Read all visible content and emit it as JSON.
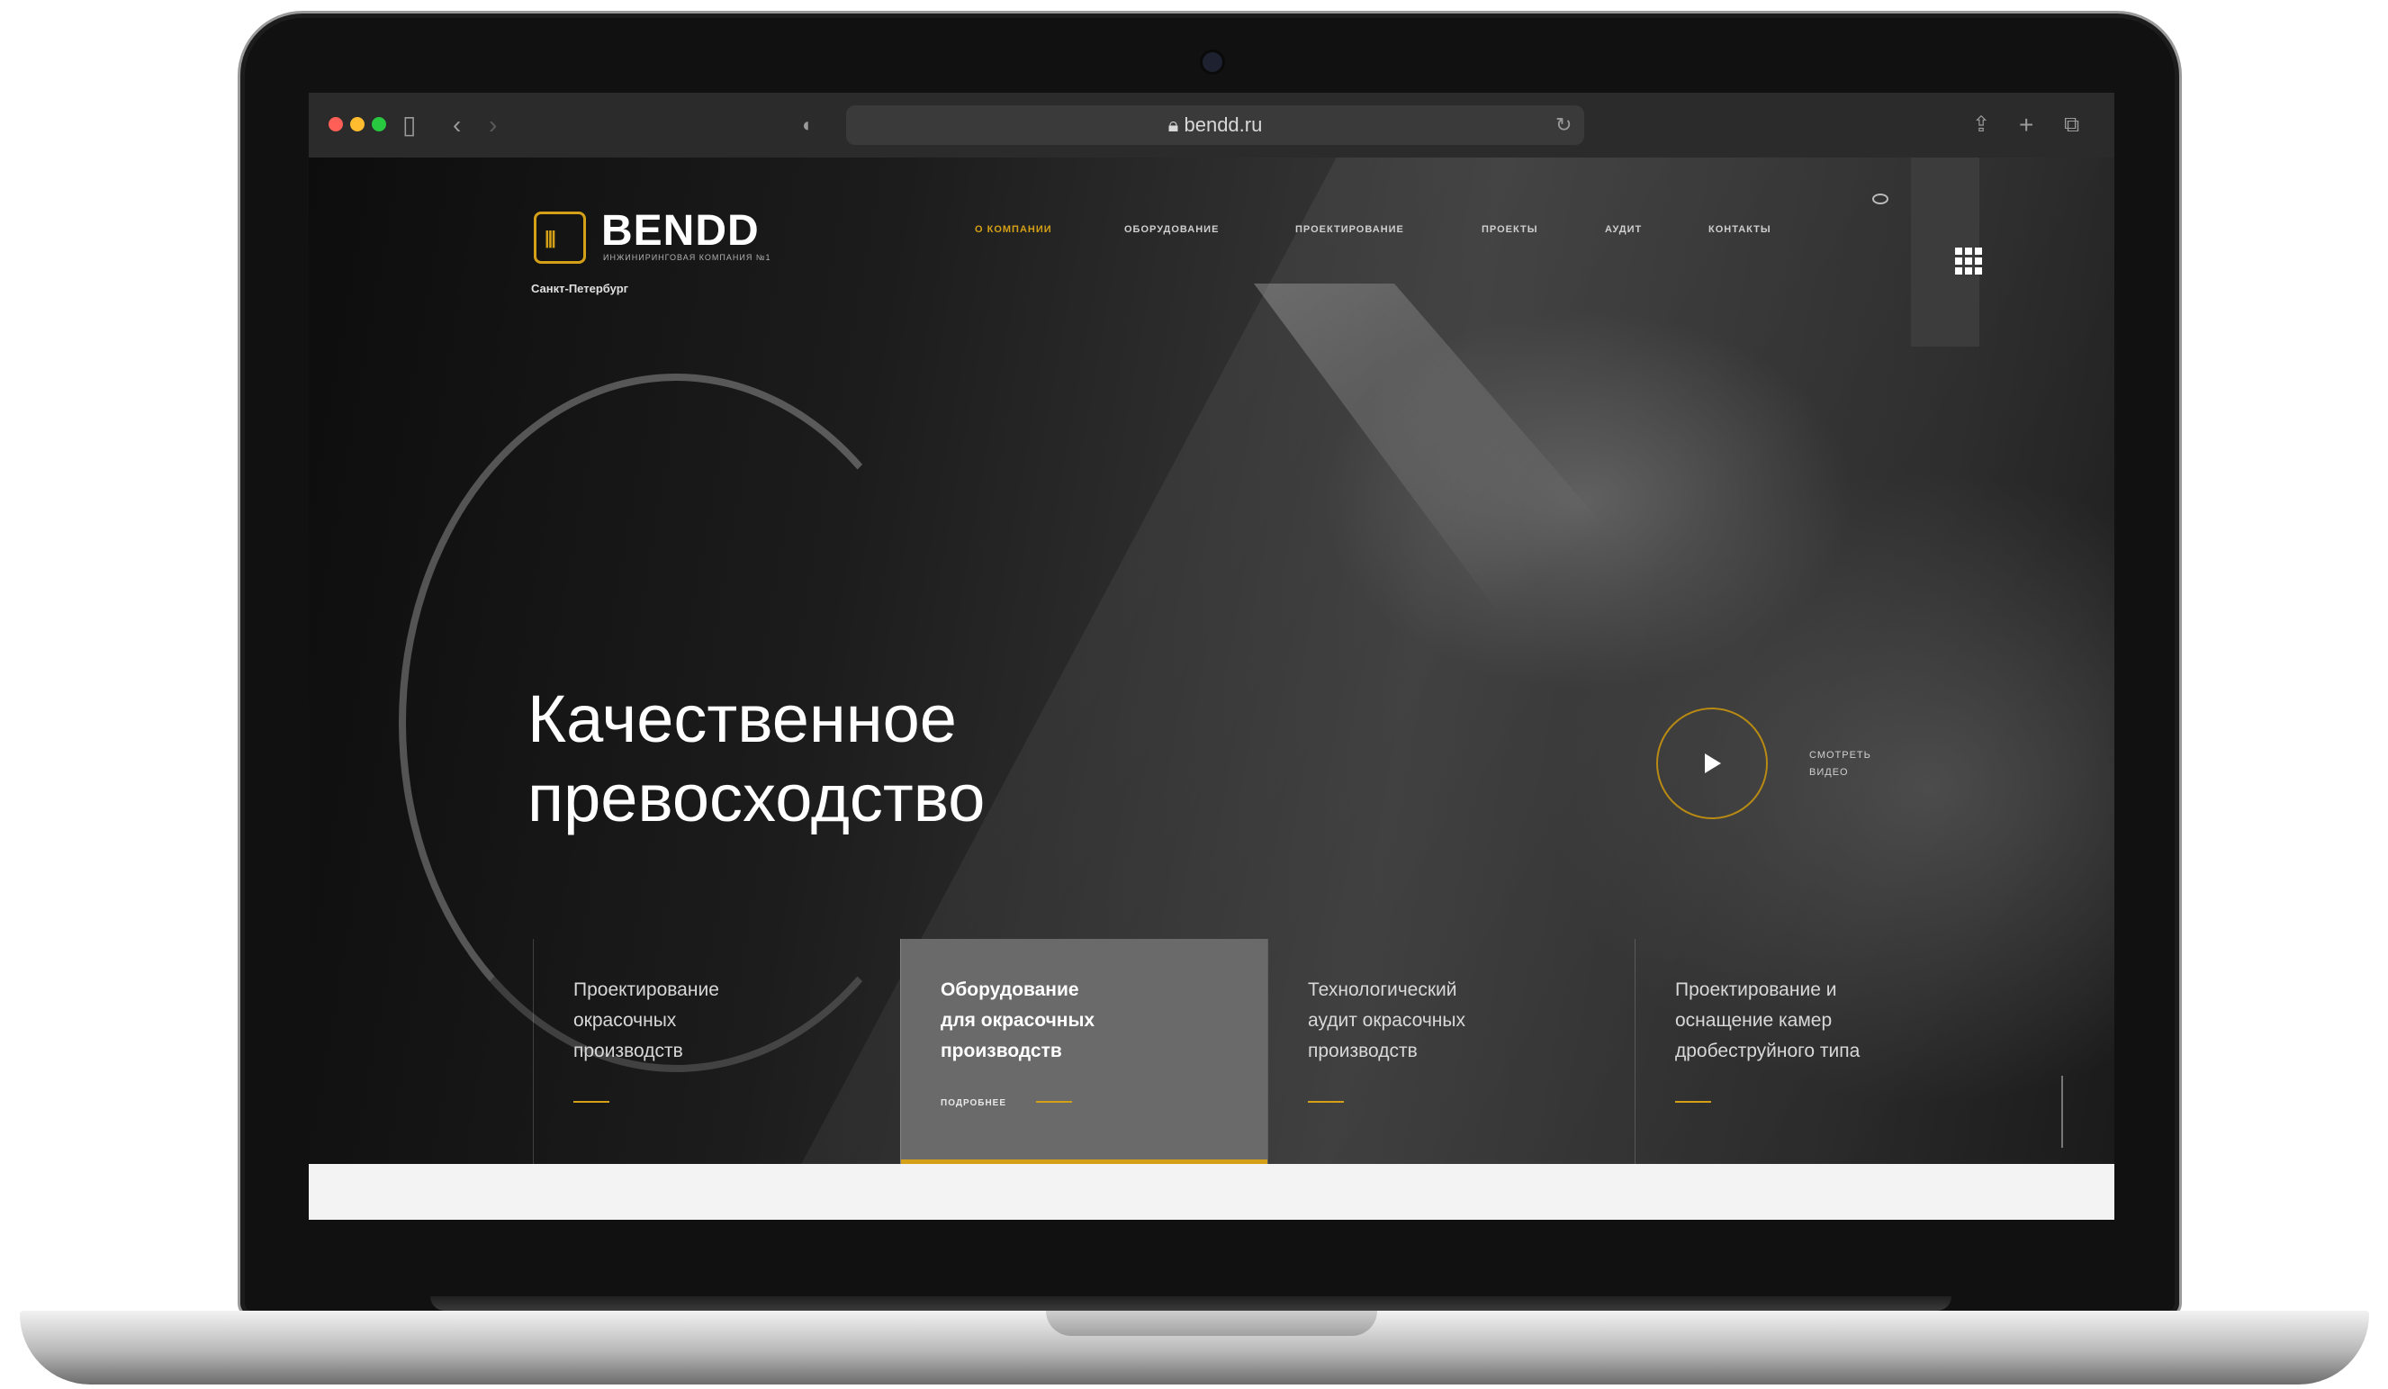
{
  "browser": {
    "url": "bendd.ru",
    "icons": [
      "sidebar-icon",
      "back-icon",
      "forward-icon",
      "shield-icon",
      "reload-icon",
      "share-icon",
      "new-tab-icon",
      "tabs-icon"
    ]
  },
  "site": {
    "logo_text": "BENDD",
    "logo_tagline": "ИНЖИНИРИНГОВАЯ КОМПАНИЯ №1",
    "city": "Санкт-Петербург",
    "nav": [
      "О КОМПАНИИ",
      "ОБОРУДОВАНИЕ",
      "ПРОЕКТИРОВАНИЕ",
      "ПРОЕКТЫ",
      "АУДИТ",
      "КОНТАКТЫ"
    ],
    "hero_line1": "Качественное",
    "hero_line2": "превосходство",
    "watch_line1": "СМОТРЕТЬ",
    "watch_line2": "ВИДЕО",
    "cards": [
      {
        "line1": "Проектирование",
        "line2": "окрасочных",
        "line3": "производств"
      },
      {
        "line1": "Оборудование",
        "line2": "для окрасочных",
        "line3": "производств",
        "more": "ПОДРОБНЕЕ"
      },
      {
        "line1": "Технологический",
        "line2": "аудит окрасочных",
        "line3": "производств"
      },
      {
        "line1": "Проектирование и",
        "line2": "оснащение камер",
        "line3": "дробеструйного типа"
      }
    ]
  },
  "colors": {
    "accent": "#d4a017",
    "background": "#1a1a1a"
  }
}
